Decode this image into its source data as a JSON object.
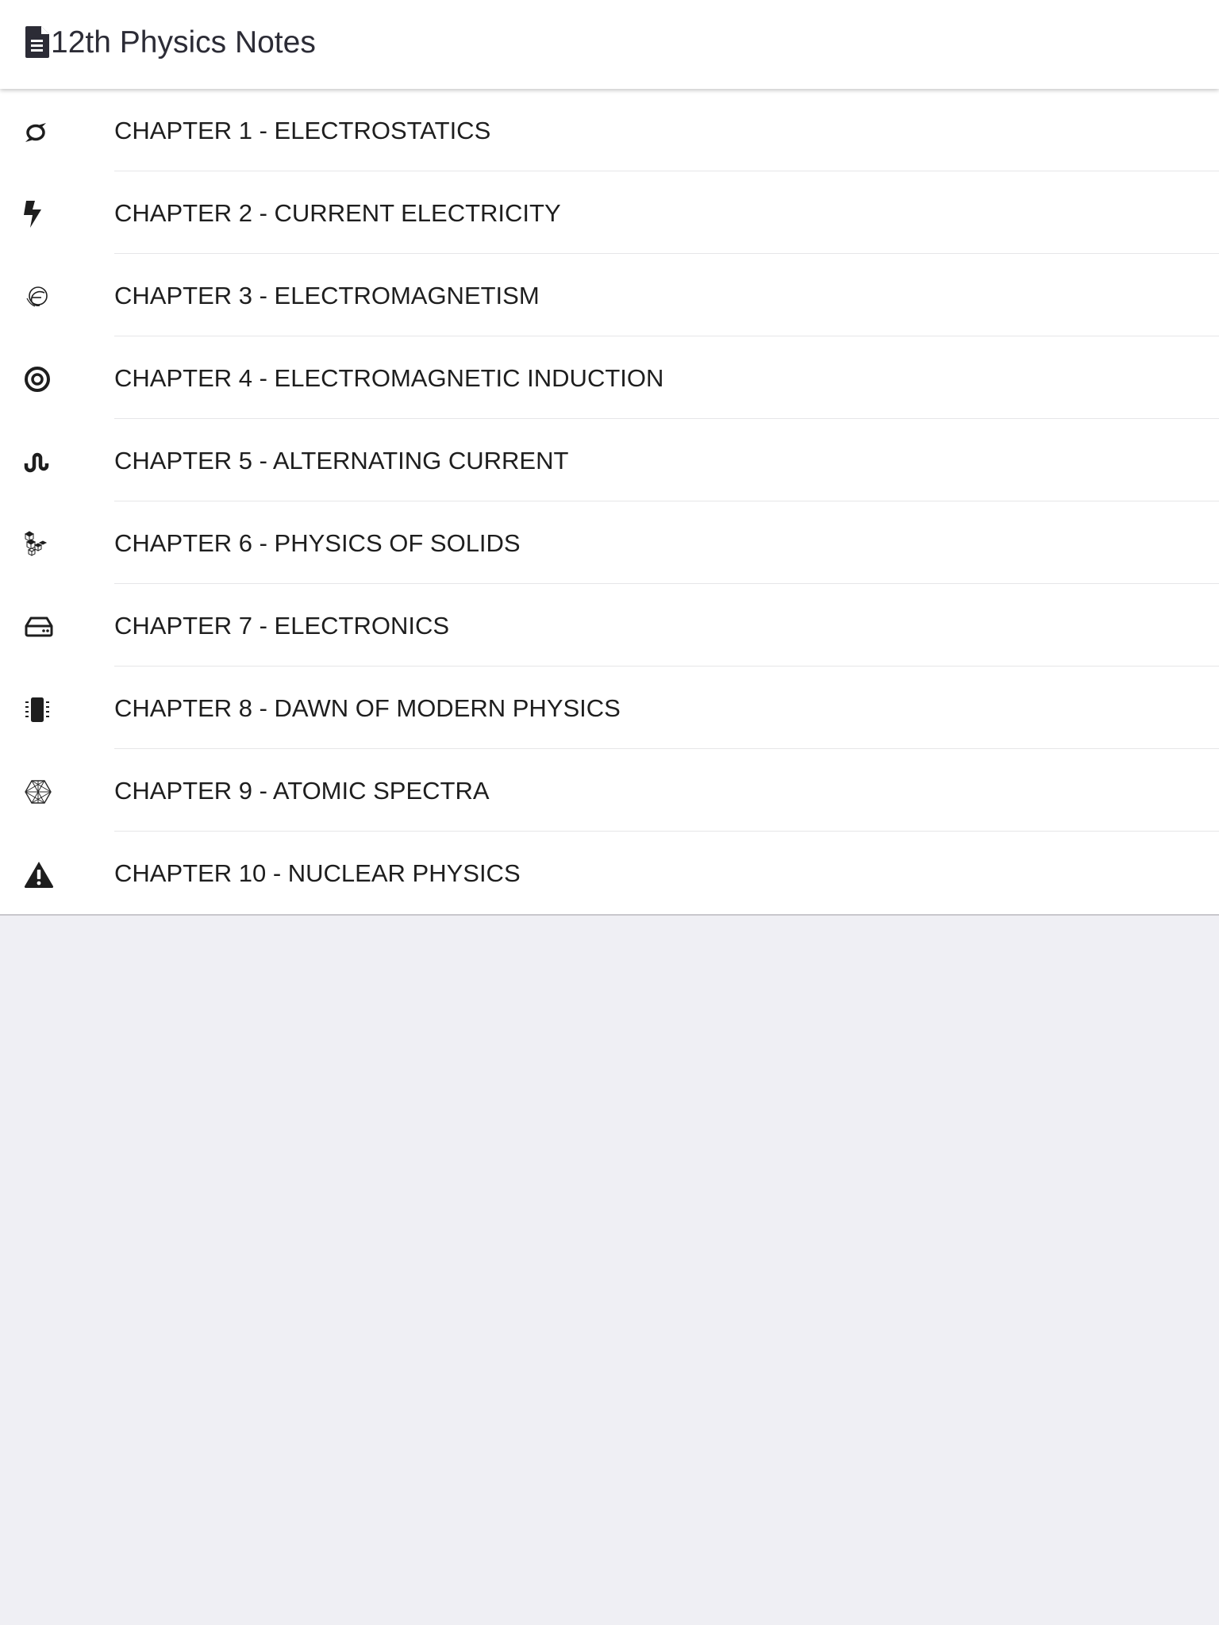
{
  "header": {
    "title": "12th Physics Notes",
    "icon": "file-text-icon"
  },
  "chapters": [
    {
      "label": "CHAPTER 1 - ELECTROSTATICS",
      "icon": "hurricane-icon"
    },
    {
      "label": "CHAPTER 2 - CURRENT ELECTRICITY",
      "icon": "bolt-icon"
    },
    {
      "label": "CHAPTER 3 - ELECTROMAGNETISM",
      "icon": "orbit-icon"
    },
    {
      "label": "CHAPTER 4 - ELECTROMAGNETIC INDUCTION",
      "icon": "bullseye-icon"
    },
    {
      "label": "CHAPTER 5 - ALTERNATING CURRENT",
      "icon": "wave-icon"
    },
    {
      "label": "CHAPTER 6 - PHYSICS OF SOLIDS",
      "icon": "cubes-icon"
    },
    {
      "label": "CHAPTER 7 - ELECTRONICS",
      "icon": "hard-drive-icon"
    },
    {
      "label": "CHAPTER 8 - DAWN OF MODERN PHYSICS",
      "icon": "microchip-icon"
    },
    {
      "label": "CHAPTER 9 - ATOMIC SPECTRA",
      "icon": "hexagon-mesh-icon"
    },
    {
      "label": "CHAPTER 10 - NUCLEAR PHYSICS",
      "icon": "warning-icon"
    }
  ]
}
